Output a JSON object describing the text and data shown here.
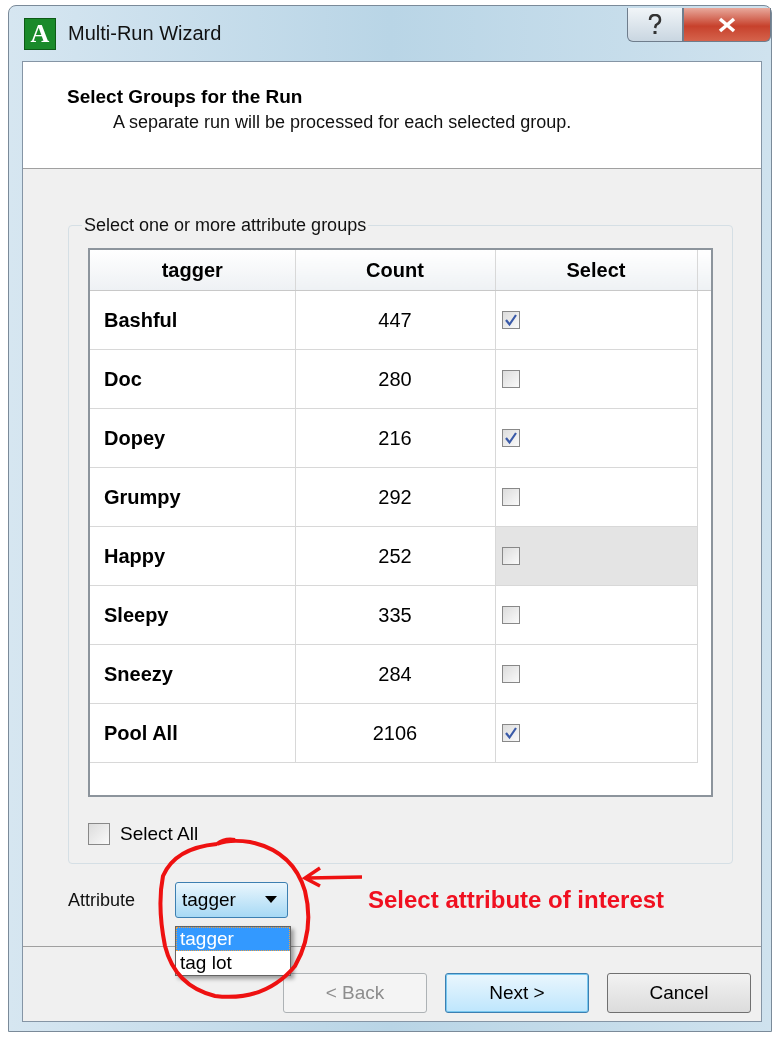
{
  "window": {
    "icon_letter": "A",
    "title": "Multi-Run Wizard"
  },
  "header": {
    "title": "Select Groups for the Run",
    "subtitle": "A separate run will be processed for each selected group."
  },
  "group": {
    "legend": "Select one or more attribute groups",
    "table": {
      "columns": [
        "tagger",
        "Count",
        "Select"
      ],
      "rows": [
        {
          "name": "Bashful",
          "count": "447",
          "checked": true,
          "hovered": false
        },
        {
          "name": "Doc",
          "count": "280",
          "checked": false,
          "hovered": false
        },
        {
          "name": "Dopey",
          "count": "216",
          "checked": true,
          "hovered": false
        },
        {
          "name": "Grumpy",
          "count": "292",
          "checked": false,
          "hovered": false
        },
        {
          "name": "Happy",
          "count": "252",
          "checked": false,
          "hovered": true
        },
        {
          "name": "Sleepy",
          "count": "335",
          "checked": false,
          "hovered": false
        },
        {
          "name": "Sneezy",
          "count": "284",
          "checked": false,
          "hovered": false
        },
        {
          "name": "Pool All",
          "count": "2106",
          "checked": true,
          "hovered": false
        }
      ]
    },
    "select_all": {
      "label": "Select All",
      "checked": false
    }
  },
  "attribute": {
    "label": "Attribute",
    "value": "tagger",
    "options": [
      {
        "label": "tagger",
        "selected": true
      },
      {
        "label": "tag lot",
        "selected": false
      }
    ]
  },
  "annotation": {
    "text": "Select attribute of interest"
  },
  "buttons": [
    {
      "label": "< Back",
      "disabled": true,
      "default": false
    },
    {
      "label": "Next >",
      "disabled": false,
      "default": true
    },
    {
      "label": "Cancel",
      "disabled": false,
      "default": false
    }
  ]
}
